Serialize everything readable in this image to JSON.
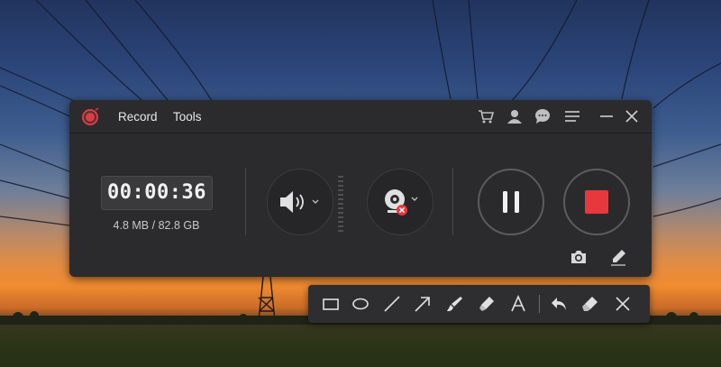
{
  "window": {
    "menu": [
      {
        "label": "Record"
      },
      {
        "label": "Tools"
      }
    ],
    "title_icons": [
      "cart-icon",
      "user-icon",
      "chat-icon",
      "menu-icon",
      "minimize-icon",
      "close-icon"
    ]
  },
  "recorder": {
    "timer": "00:00:36",
    "file_size": "4.8 MB / 82.8 GB",
    "controls": [
      "speaker-icon",
      "webcam-icon",
      "pause-icon",
      "stop-icon",
      "camera-icon",
      "pen-icon"
    ],
    "stop_color": "#e8383d",
    "logo_color": "#e8383d"
  },
  "draw_tools": [
    "rectangle-icon",
    "ellipse-icon",
    "line-icon",
    "arrow-icon",
    "brush-icon",
    "highlighter-icon",
    "text-icon",
    "undo-icon",
    "eraser-icon",
    "close-icon"
  ]
}
